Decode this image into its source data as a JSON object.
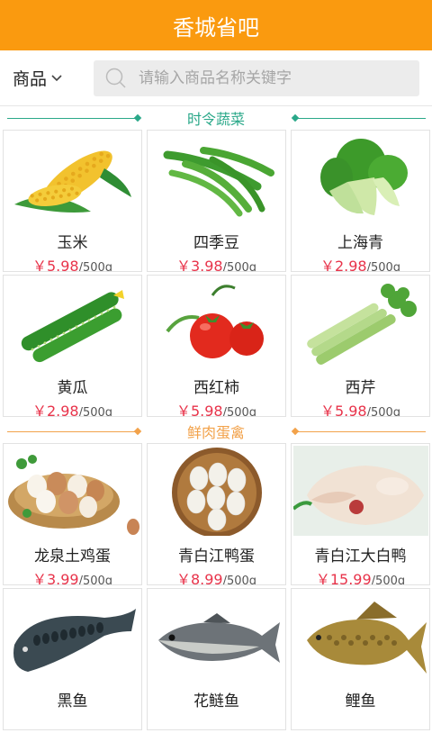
{
  "header": {
    "title": "香城省吧"
  },
  "search": {
    "category_label": "商品",
    "placeholder": "请输入商品名称关键字"
  },
  "colors": {
    "brand": "#fa9a0f",
    "price": "#e8334a",
    "sec1": "#2aa889",
    "sec2": "#f2a24a"
  },
  "sections": [
    {
      "title": "时令蔬菜",
      "items": [
        {
          "name": "玉米",
          "price": "￥5.98",
          "unit": "/500g",
          "icon": "corn-icon"
        },
        {
          "name": "四季豆",
          "price": "￥3.98",
          "unit": "/500g",
          "icon": "green-bean-icon"
        },
        {
          "name": "上海青",
          "price": "￥2.98",
          "unit": "/500g",
          "icon": "bok-choy-icon"
        },
        {
          "name": "黄瓜",
          "price": "￥2.98",
          "unit": "/500g",
          "icon": "cucumber-icon"
        },
        {
          "name": "西红柿",
          "price": "￥5.98",
          "unit": "/500g",
          "icon": "tomato-icon"
        },
        {
          "name": "西芹",
          "price": "￥5.98",
          "unit": "/500g",
          "icon": "celery-icon"
        }
      ]
    },
    {
      "title": "鲜肉蛋禽",
      "items": [
        {
          "name": "龙泉土鸡蛋",
          "price": "￥3.99",
          "unit": "/500g",
          "icon": "chicken-egg-icon"
        },
        {
          "name": "青白江鸭蛋",
          "price": "￥8.99",
          "unit": "/500g",
          "icon": "duck-egg-icon"
        },
        {
          "name": "青白江大白鸭",
          "price": "￥15.99",
          "unit": "/500g",
          "icon": "duck-icon"
        },
        {
          "name": "黑鱼",
          "price": "",
          "unit": "",
          "icon": "snakehead-fish-icon"
        },
        {
          "name": "花鲢鱼",
          "price": "",
          "unit": "",
          "icon": "bighead-carp-icon"
        },
        {
          "name": "鲤鱼",
          "price": "",
          "unit": "",
          "icon": "carp-icon"
        }
      ]
    }
  ]
}
